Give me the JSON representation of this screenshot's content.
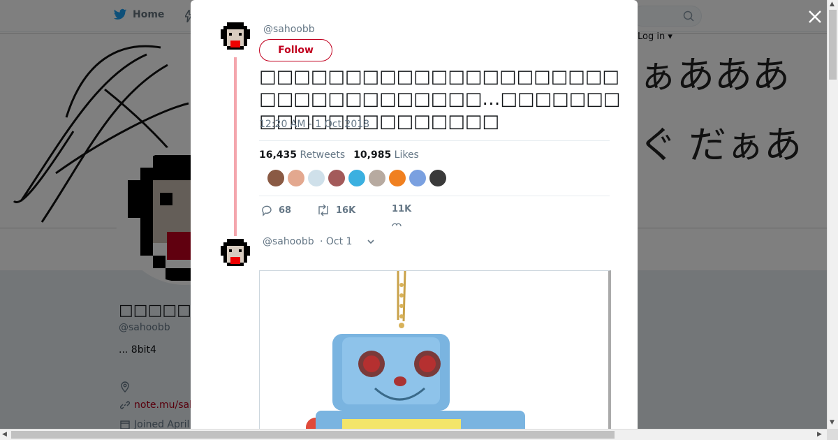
{
  "nav": {
    "home_label": "Home",
    "login_label": "Log in"
  },
  "banner": {
    "line1": "ぁあああ",
    "line2": "ぐ だぁあ"
  },
  "profile": {
    "name": "□□□□□",
    "handle": "@sahoobb",
    "bio": "... 8bit4",
    "url": "note.mu/sah",
    "joined": "Joined April"
  },
  "tweet": {
    "handle": "@sahoobb",
    "follow_label": "Follow",
    "text": "□□□□□□□□□□□□□□□□□□□□□□□□□□□□□□□□□□…□□□□□□□□□□□□□□□□□□□□□",
    "timestamp": "12:20 AM - 1 Oct 2018",
    "retweets_count": "16,435",
    "retweets_label": "Retweets",
    "likes_count": "10,985",
    "likes_label": "Likes",
    "reply_count": "68",
    "retweet_count_short": "16K",
    "like_count_short": "11K"
  },
  "reply": {
    "handle": "@sahoobb",
    "date": "· Oct 1"
  },
  "colors": {
    "accent": "#c1001f",
    "thread_line": "#f4a6ad",
    "overlay": "rgba(0,0,0,0.5)"
  }
}
